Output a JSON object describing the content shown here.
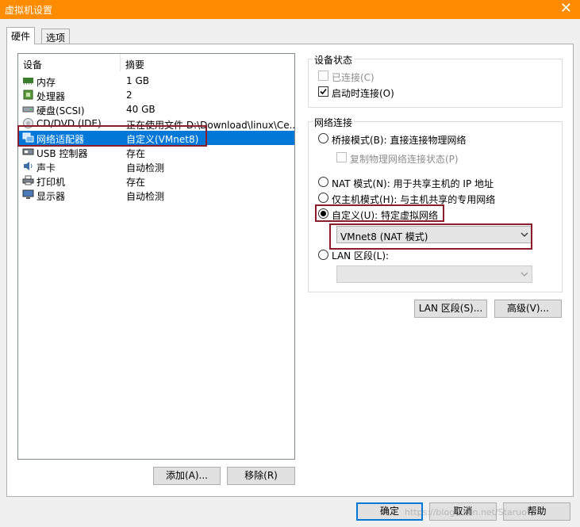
{
  "window": {
    "title": "虚拟机设置",
    "close_glyph": "✕"
  },
  "tabs": [
    {
      "label": "硬件"
    },
    {
      "label": "选项"
    }
  ],
  "device_list": {
    "col_device": "设备",
    "col_summary": "摘要",
    "rows": [
      {
        "name": "内存",
        "summary": "1 GB",
        "icon": "memory-icon"
      },
      {
        "name": "处理器",
        "summary": "2",
        "icon": "processor-icon"
      },
      {
        "name": "硬盘(SCSI)",
        "summary": "40 GB",
        "icon": "harddisk-icon"
      },
      {
        "name": "CD/DVD (IDE)",
        "summary": "正在使用文件 D:\\Download\\linux\\Ce...",
        "icon": "cd-icon"
      },
      {
        "name": "网络适配器",
        "summary": "自定义(VMnet8)",
        "icon": "network-adapter-icon"
      },
      {
        "name": "USB 控制器",
        "summary": "存在",
        "icon": "usb-icon"
      },
      {
        "name": "声卡",
        "summary": "自动检测",
        "icon": "sound-icon"
      },
      {
        "name": "打印机",
        "summary": "存在",
        "icon": "printer-icon"
      },
      {
        "name": "显示器",
        "summary": "自动检测",
        "icon": "display-icon"
      }
    ]
  },
  "list_buttons": {
    "add": "添加(A)...",
    "remove": "移除(R)"
  },
  "device_status": {
    "title": "设备状态",
    "connected": "已连接(C)",
    "connect_at_power_on": "启动时连接(O)"
  },
  "network": {
    "title": "网络连接",
    "bridged": "桥接模式(B): 直接连接物理网络",
    "replicate": "复制物理网络连接状态(P)",
    "nat": "NAT 模式(N): 用于共享主机的 IP 地址",
    "host_only": "仅主机模式(H): 与主机共享的专用网络",
    "custom": "自定义(U): 特定虚拟网络",
    "custom_value": "VMnet8 (NAT 模式)",
    "lan": "LAN 区段(L):",
    "lan_value": ""
  },
  "network_buttons": {
    "lan_segments": "LAN 区段(S)...",
    "advanced": "高级(V)..."
  },
  "footer": {
    "ok": "确定",
    "cancel": "取消",
    "help": "帮助"
  },
  "watermark": "https://blog.csdn.net/Staruoch",
  "colors": {
    "titlebar": "#ff8c00",
    "selection": "#0078d7",
    "highlight_box": "#8b1c2c"
  }
}
